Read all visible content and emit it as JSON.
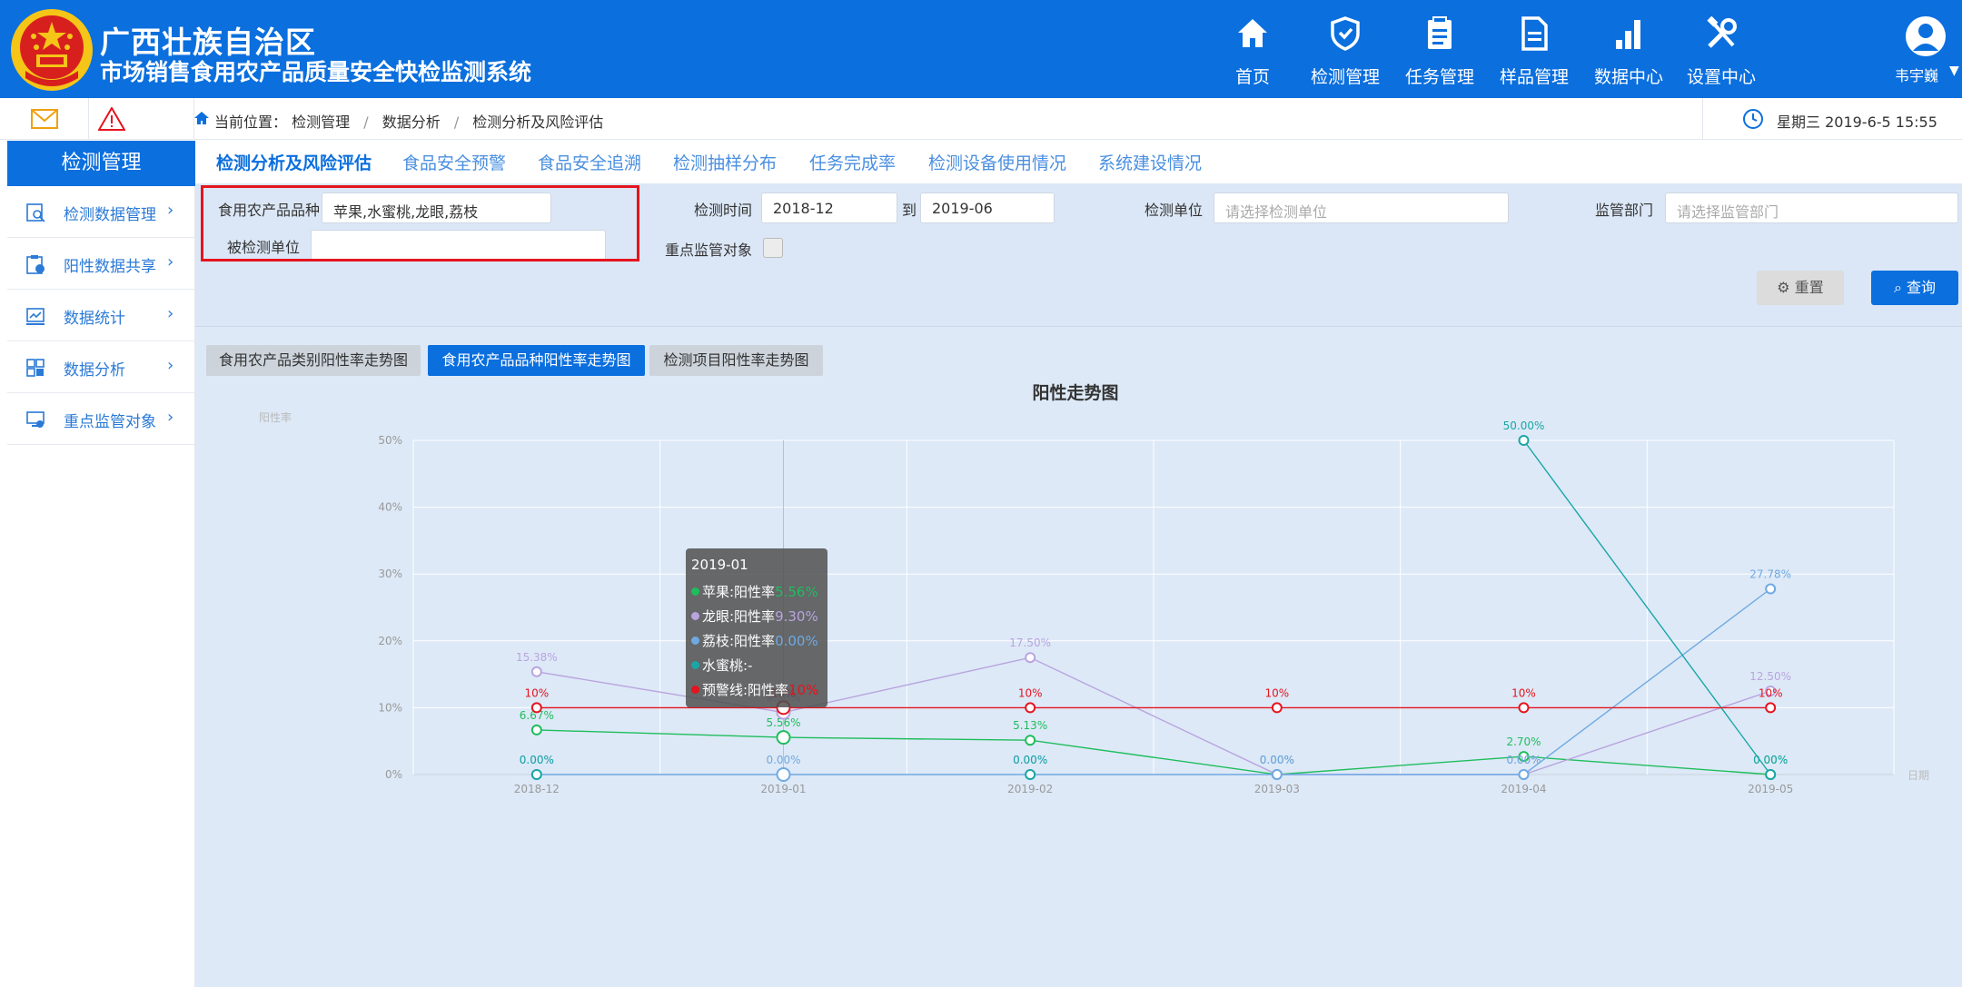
{
  "header": {
    "title_line1": "广西壮族自治区",
    "title_line2": "市场销售食用农产品质量安全快检监测系统",
    "nav": [
      {
        "label": "首页",
        "icon": "home-icon"
      },
      {
        "label": "检测管理",
        "icon": "shield-icon"
      },
      {
        "label": "任务管理",
        "icon": "clipboard-icon"
      },
      {
        "label": "样品管理",
        "icon": "document-icon"
      },
      {
        "label": "数据中心",
        "icon": "bar-chart-icon"
      },
      {
        "label": "设置中心",
        "icon": "tools-icon"
      }
    ],
    "user": {
      "name": "韦宇巍",
      "arrow": "▼"
    }
  },
  "breadcrumb": {
    "prefix": "当前位置：",
    "items": [
      "检测管理",
      "数据分析",
      "检测分析及风险评估"
    ],
    "sep": "/",
    "date": "星期三   2019-6-5  15:55"
  },
  "sidebar": {
    "title": "检测管理",
    "items": [
      {
        "label": "检测数据管理",
        "icon": "data-manage-icon",
        "arrow": "›"
      },
      {
        "label": "阳性数据共享",
        "icon": "share-icon",
        "arrow": "›"
      },
      {
        "label": "数据统计",
        "icon": "statistics-icon",
        "arrow": "›"
      },
      {
        "label": "数据分析",
        "icon": "analysis-icon",
        "arrow": "›"
      },
      {
        "label": "重点监管对象",
        "icon": "monitor-icon",
        "arrow": "›"
      }
    ]
  },
  "tabs": [
    "检测分析及风险评估",
    "食品安全预警",
    "食品安全追溯",
    "检测抽样分布",
    "任务完成率",
    "检测设备使用情况",
    "系统建设情况"
  ],
  "filters": {
    "variety_label": "食用农产品品种",
    "variety_value": "苹果,水蜜桃,龙眼,荔枝",
    "tested_unit_label": "被检测单位",
    "tested_unit_value": "",
    "time_label": "检测时间",
    "time_from": "2018-12",
    "time_to_label": "到",
    "time_to": "2019-06",
    "unit_label": "检测单位",
    "unit_placeholder": "请选择检测单位",
    "dept_label": "监管部门",
    "dept_placeholder": "请选择监管部门",
    "key_object_label": "重点监管对象",
    "reset_label": "重置",
    "query_label": "查询"
  },
  "chart_tabs": [
    "食用农产品类别阳性率走势图",
    "食用农产品品种阳性率走势图",
    "检测项目阳性率走势图"
  ],
  "colors": {
    "brand": "#0b6fde",
    "apple": "#1fbd5c",
    "longan": "#b9a4df",
    "lychee": "#6fa9e2",
    "peach": "#1aa6a6",
    "warning": "#e5141e"
  },
  "chart_data": {
    "type": "line",
    "title": "阳性走势图",
    "ylabel": "阳性率",
    "xlabel": "日期",
    "categories": [
      "2018-12",
      "2019-01",
      "2019-02",
      "2019-03",
      "2019-04",
      "2019-05"
    ],
    "ylim": [
      0,
      50
    ],
    "yticks": [
      "0%",
      "10%",
      "20%",
      "30%",
      "40%",
      "50%"
    ],
    "series": [
      {
        "name": "苹果",
        "values": [
          6.67,
          5.56,
          5.13,
          0,
          2.7,
          0
        ],
        "labels": [
          "6.67%",
          "5.56%",
          "5.13%",
          "0.00%",
          "2.70%",
          "0.00%"
        ],
        "color": "#1fbd5c"
      },
      {
        "name": "龙眼",
        "values": [
          15.38,
          9.3,
          17.5,
          0,
          0,
          12.5
        ],
        "labels": [
          "15.38%",
          "9.30%",
          "17.50%",
          "0.00%",
          "0.00%",
          "12.50%"
        ],
        "color": "#b9a4df"
      },
      {
        "name": "荔枝",
        "values": [
          0,
          0,
          0,
          0,
          0,
          27.78
        ],
        "labels": [
          "0.00%",
          "0.00%",
          "0.00%",
          "0.00%",
          "0.00%",
          "27.78%"
        ],
        "color": "#6fa9e2"
      },
      {
        "name": "水蜜桃",
        "values": [
          0,
          null,
          0,
          null,
          50,
          0
        ],
        "labels": [
          "0.00%",
          "",
          "0.00%",
          "",
          "50.00%",
          "0.00%"
        ],
        "color": "#1aa6a6"
      },
      {
        "name": "预警线",
        "values": [
          10,
          10,
          10,
          10,
          10,
          10
        ],
        "labels": [
          "10%",
          "10%",
          "10%",
          "10%",
          "10%",
          "10%"
        ],
        "color": "#e5141e"
      }
    ],
    "grid": true,
    "tooltip": {
      "title": "2019-01",
      "rows": [
        {
          "label": "苹果:阳性率",
          "value": "5.56%",
          "color": "#1fbd5c"
        },
        {
          "label": "龙眼:阳性率",
          "value": "9.30%",
          "color": "#b9a4df"
        },
        {
          "label": "荔枝:阳性率",
          "value": "0.00%",
          "color": "#6fa9e2"
        },
        {
          "label": "水蜜桃:-",
          "value": "",
          "color": "#1aa6a6"
        },
        {
          "label": "预警线:阳性率",
          "value": "10%",
          "color": "#e5141e"
        }
      ]
    }
  }
}
